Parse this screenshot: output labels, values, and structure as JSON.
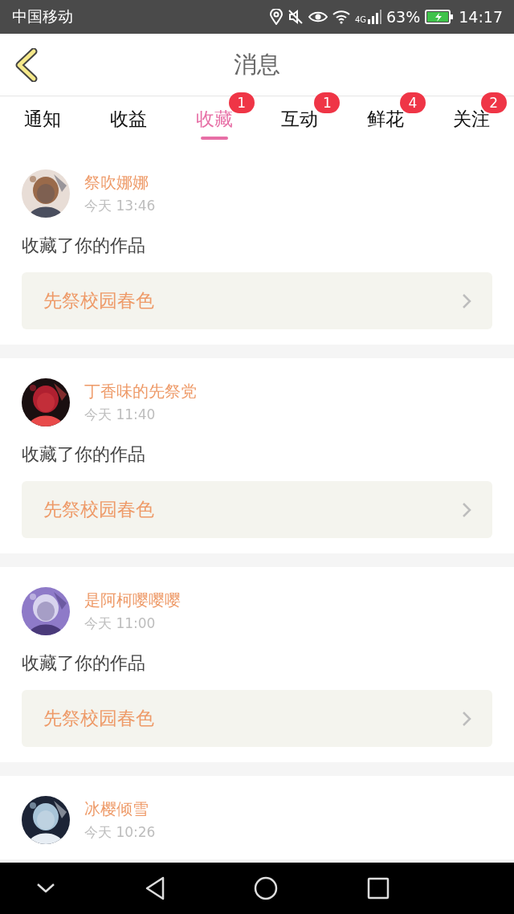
{
  "status_bar": {
    "carrier": "中国移动",
    "network": "4G",
    "battery": "63%",
    "time": "14:17"
  },
  "header": {
    "title": "消息"
  },
  "tabs": [
    {
      "label": "通知",
      "selected": false
    },
    {
      "label": "收益",
      "selected": false
    },
    {
      "label": "收藏",
      "selected": true,
      "badge": "1"
    },
    {
      "label": "互动",
      "selected": false,
      "badge": "1"
    },
    {
      "label": "鲜花",
      "selected": false,
      "badge": "4"
    },
    {
      "label": "关注",
      "selected": false,
      "badge": "2"
    }
  ],
  "messages": [
    {
      "user": "祭吹娜娜",
      "time": "今天 13:46",
      "action": "收藏了你的作品",
      "work": "先祭校园春色"
    },
    {
      "user": "丁香味的先祭党",
      "time": "今天 11:40",
      "action": "收藏了你的作品",
      "work": "先祭校园春色"
    },
    {
      "user": "是阿柯嘤嘤嘤",
      "time": "今天 11:00",
      "action": "收藏了你的作品",
      "work": "先祭校园春色"
    },
    {
      "user": "冰樱倾雪",
      "time": "今天 10:26"
    }
  ]
}
